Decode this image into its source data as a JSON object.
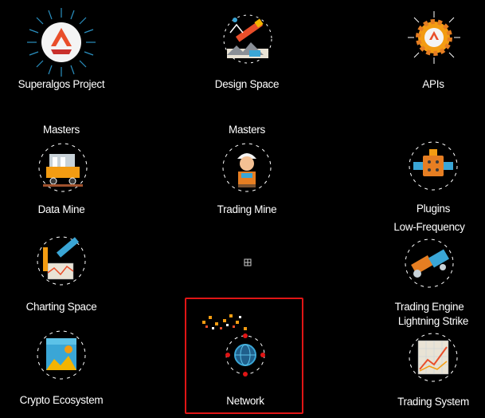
{
  "nodes": {
    "superalgos_project": {
      "label": "Superalgos Project",
      "icon": "superalgos-logo-icon"
    },
    "design_space": {
      "label": "Design Space",
      "icon": "design-space-icon"
    },
    "apis": {
      "label": "APIs",
      "icon": "apis-gear-icon"
    },
    "data_mine": {
      "top_label": "Masters",
      "label": "Data Mine",
      "icon": "mine-cart-icon"
    },
    "trading_mine": {
      "top_label": "Masters",
      "label": "Trading Mine",
      "icon": "miner-icon"
    },
    "plugins": {
      "label": "Plugins",
      "icon": "plugin-icon"
    },
    "charting_space": {
      "label": "Charting Space",
      "icon": "charting-space-icon"
    },
    "trading_engine": {
      "top_label": "Low-Frequency",
      "label": "Trading Engine",
      "icon": "trading-engine-icon"
    },
    "crypto_ecosystem": {
      "label": "Crypto Ecosystem",
      "icon": "crypto-ecosystem-icon"
    },
    "network": {
      "label": "Network",
      "icon": "network-globe-icon"
    },
    "trading_system": {
      "top_label": "Lightning Strike",
      "label": "Trading System",
      "icon": "trading-system-icon"
    }
  },
  "colors": {
    "background": "#000000",
    "selection_border": "#e01515",
    "text": "#ffffff"
  }
}
